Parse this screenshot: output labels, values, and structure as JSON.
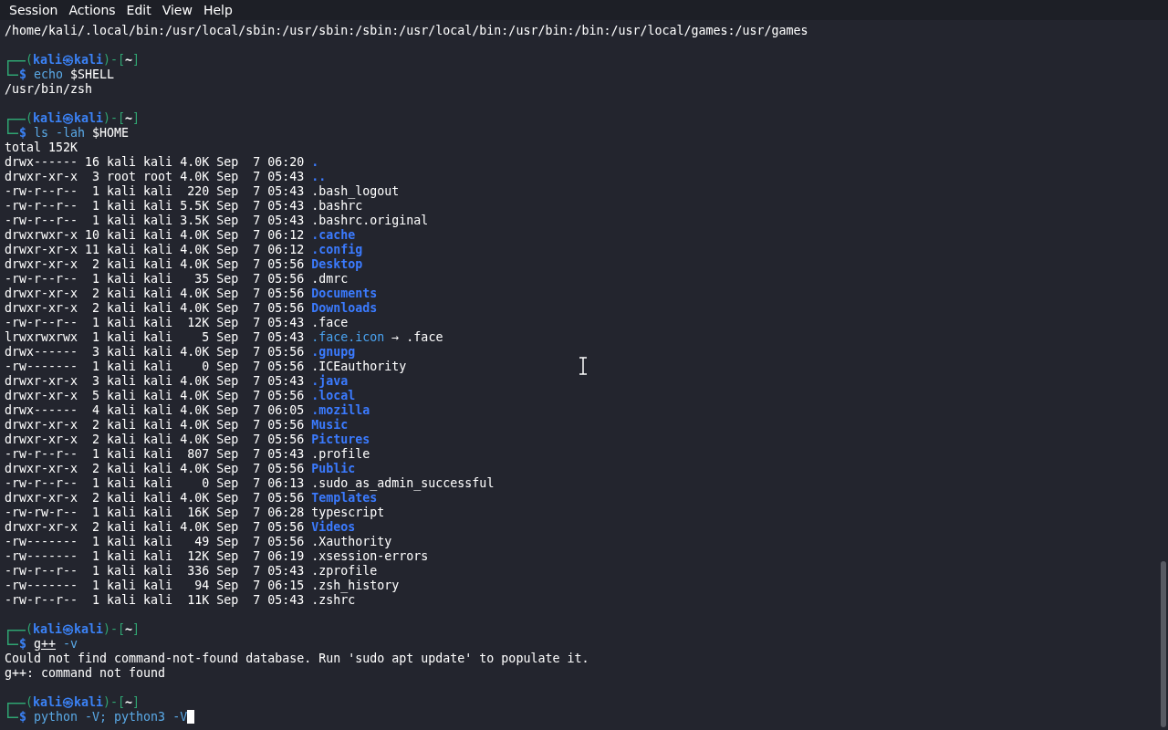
{
  "menu": [
    "Session",
    "Actions",
    "Edit",
    "View",
    "Help"
  ],
  "lines": [
    {
      "kind": "output",
      "text": "/home/kali/.local/bin:/usr/local/sbin:/usr/sbin:/sbin:/usr/local/bin:/usr/bin:/bin:/usr/local/games:/usr/games"
    },
    {
      "kind": "blank"
    },
    {
      "kind": "prompt",
      "head": "(**kali㉿kali**)-[*~*]",
      "symbol": "$",
      "segments": [
        {
          "text": "echo",
          "color": "#5aa9e6",
          "underlined": false
        },
        {
          "text": " $SHELL",
          "color": "#ffffff",
          "underlined": false
        }
      ]
    },
    {
      "kind": "output",
      "text": "/usr/bin/zsh"
    },
    {
      "kind": "blank"
    },
    {
      "kind": "prompt",
      "head": "(**kali㉿kali**)-[*~*]",
      "symbol": "$",
      "segments": [
        {
          "text": "ls -lah",
          "color": "#5aa9e6",
          "underlined": false
        },
        {
          "text": " $HOME",
          "color": "#ffffff",
          "underlined": false
        }
      ]
    },
    {
      "kind": "output",
      "text": "total 152K"
    },
    {
      "kind": "entry",
      "info": "drwx------ 16 kali kali 4.0K Sep  7 06:20",
      "file": {
        "name": ".",
        "kind": "dir"
      }
    },
    {
      "kind": "entry",
      "info": "drwxr-xr-x  3 root root 4.0K Sep  7 05:43",
      "file": {
        "name": "..",
        "kind": "dir"
      }
    },
    {
      "kind": "entry",
      "info": "-rw-r--r--  1 kali kali  220 Sep  7 05:43",
      "file": {
        "name": ".bash_logout",
        "kind": "file"
      }
    },
    {
      "kind": "entry",
      "info": "-rw-r--r--  1 kali kali 5.5K Sep  7 05:43",
      "file": {
        "name": ".bashrc",
        "kind": "file"
      }
    },
    {
      "kind": "entry",
      "info": "-rw-r--r--  1 kali kali 3.5K Sep  7 05:43",
      "file": {
        "name": ".bashrc.original",
        "kind": "file"
      }
    },
    {
      "kind": "entry",
      "info": "drwxrwxr-x 10 kali kali 4.0K Sep  7 06:12",
      "file": {
        "name": ".cache",
        "kind": "dir"
      }
    },
    {
      "kind": "entry",
      "info": "drwxr-xr-x 11 kali kali 4.0K Sep  7 06:12",
      "file": {
        "name": ".config",
        "kind": "dir"
      }
    },
    {
      "kind": "entry",
      "info": "drwxr-xr-x  2 kali kali 4.0K Sep  7 05:56",
      "file": {
        "name": "Desktop",
        "kind": "dir"
      }
    },
    {
      "kind": "entry",
      "info": "-rw-r--r--  1 kali kali   35 Sep  7 05:56",
      "file": {
        "name": ".dmrc",
        "kind": "file"
      }
    },
    {
      "kind": "entry",
      "info": "drwxr-xr-x  2 kali kali 4.0K Sep  7 05:56",
      "file": {
        "name": "Documents",
        "kind": "dir"
      }
    },
    {
      "kind": "entry",
      "info": "drwxr-xr-x  2 kali kali 4.0K Sep  7 05:56",
      "file": {
        "name": "Downloads",
        "kind": "dir"
      }
    },
    {
      "kind": "entry",
      "info": "-rw-r--r--  1 kali kali  12K Sep  7 05:43",
      "file": {
        "name": ".face",
        "kind": "file"
      }
    },
    {
      "kind": "entry",
      "info": "lrwxrwxrwx  1 kali kali    5 Sep  7 05:43",
      "file": {
        "name": ".face.icon",
        "kind": "link",
        "arrow": "→",
        "target": ".face"
      }
    },
    {
      "kind": "entry",
      "info": "drwx------  3 kali kali 4.0K Sep  7 05:56",
      "file": {
        "name": ".gnupg",
        "kind": "dir"
      }
    },
    {
      "kind": "entry",
      "info": "-rw-------  1 kali kali    0 Sep  7 05:56",
      "file": {
        "name": ".ICEauthority",
        "kind": "file"
      }
    },
    {
      "kind": "entry",
      "info": "drwxr-xr-x  3 kali kali 4.0K Sep  7 05:43",
      "file": {
        "name": ".java",
        "kind": "dir"
      }
    },
    {
      "kind": "entry",
      "info": "drwxr-xr-x  5 kali kali 4.0K Sep  7 05:56",
      "file": {
        "name": ".local",
        "kind": "dir"
      }
    },
    {
      "kind": "entry",
      "info": "drwx------  4 kali kali 4.0K Sep  7 06:05",
      "file": {
        "name": ".mozilla",
        "kind": "dir"
      }
    },
    {
      "kind": "entry",
      "info": "drwxr-xr-x  2 kali kali 4.0K Sep  7 05:56",
      "file": {
        "name": "Music",
        "kind": "dir"
      }
    },
    {
      "kind": "entry",
      "info": "drwxr-xr-x  2 kali kali 4.0K Sep  7 05:56",
      "file": {
        "name": "Pictures",
        "kind": "dir"
      }
    },
    {
      "kind": "entry",
      "info": "-rw-r--r--  1 kali kali  807 Sep  7 05:43",
      "file": {
        "name": ".profile",
        "kind": "file"
      }
    },
    {
      "kind": "entry",
      "info": "drwxr-xr-x  2 kali kali 4.0K Sep  7 05:56",
      "file": {
        "name": "Public",
        "kind": "dir"
      }
    },
    {
      "kind": "entry",
      "info": "-rw-r--r--  1 kali kali    0 Sep  7 06:13",
      "file": {
        "name": ".sudo_as_admin_successful",
        "kind": "file"
      }
    },
    {
      "kind": "entry",
      "info": "drwxr-xr-x  2 kali kali 4.0K Sep  7 05:56",
      "file": {
        "name": "Templates",
        "kind": "dir"
      }
    },
    {
      "kind": "entry",
      "info": "-rw-rw-r--  1 kali kali  16K Sep  7 06:28",
      "file": {
        "name": "typescript",
        "kind": "file"
      }
    },
    {
      "kind": "entry",
      "info": "drwxr-xr-x  2 kali kali 4.0K Sep  7 05:56",
      "file": {
        "name": "Videos",
        "kind": "dir"
      }
    },
    {
      "kind": "entry",
      "info": "-rw-------  1 kali kali   49 Sep  7 05:56",
      "file": {
        "name": ".Xauthority",
        "kind": "file"
      }
    },
    {
      "kind": "entry",
      "info": "-rw-------  1 kali kali  12K Sep  7 06:19",
      "file": {
        "name": ".xsession-errors",
        "kind": "file"
      }
    },
    {
      "kind": "entry",
      "info": "-rw-r--r--  1 kali kali  336 Sep  7 05:43",
      "file": {
        "name": ".zprofile",
        "kind": "file"
      }
    },
    {
      "kind": "entry",
      "info": "-rw-------  1 kali kali   94 Sep  7 06:15",
      "file": {
        "name": ".zsh_history",
        "kind": "file"
      }
    },
    {
      "kind": "entry",
      "info": "-rw-r--r--  1 kali kali  11K Sep  7 05:43",
      "file": {
        "name": ".zshrc",
        "kind": "file"
      }
    },
    {
      "kind": "blank"
    },
    {
      "kind": "prompt",
      "head": "(**kali㉿kali**)-[*~*]",
      "symbol": "$",
      "segments": [
        {
          "text": "g++",
          "color": "#ffffff",
          "underlined": true
        },
        {
          "text": " -v",
          "color": "#5aa9e6",
          "underlined": false
        }
      ]
    },
    {
      "kind": "output",
      "text": "Could not find command-not-found database. Run 'sudo apt update' to populate it."
    },
    {
      "kind": "output",
      "text": "g++: command not found"
    },
    {
      "kind": "blank"
    },
    {
      "kind": "prompt",
      "head": "(**kali㉿kali**)-[*~*]",
      "symbol": "$",
      "segments": [
        {
          "text": "python -V; python3 -V",
          "color": "#5aa9e6",
          "underlined": false
        }
      ],
      "cursor": true
    }
  ]
}
